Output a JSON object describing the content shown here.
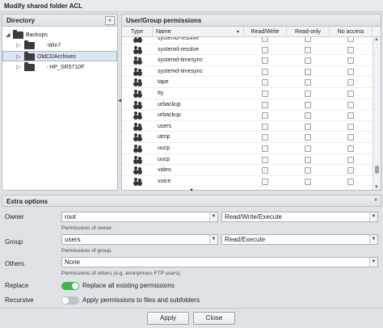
{
  "window": {
    "title": "Modify shared folder ACL"
  },
  "directory": {
    "header": "Directory",
    "collapse_glyph": "«",
    "items": [
      {
        "label": "Backups",
        "expanded": true
      },
      {
        "label": "-Win7"
      },
      {
        "label": "OldCDArchives",
        "selected": true
      },
      {
        "label": "- HP_SR5710F"
      }
    ]
  },
  "permissions": {
    "header": "User/Group permissions",
    "columns": [
      "Type",
      "Name",
      "Read/Write",
      "Read-only",
      "No access"
    ],
    "sort_glyph": "▲",
    "rows": [
      {
        "name": "systemd-resolve"
      },
      {
        "name": "systemd-resolve"
      },
      {
        "name": "systemd-timesync"
      },
      {
        "name": "systemd-timesync"
      },
      {
        "name": "tape"
      },
      {
        "name": "tty"
      },
      {
        "name": "urbackup"
      },
      {
        "name": "urbackup"
      },
      {
        "name": "users"
      },
      {
        "name": "utmp"
      },
      {
        "name": "uucp"
      },
      {
        "name": "uucp"
      },
      {
        "name": "video"
      },
      {
        "name": "voice"
      }
    ]
  },
  "extra_options": {
    "header": "Extra options",
    "owner": {
      "label": "Owner",
      "value": "root",
      "perm": "Read/Write/Execute",
      "hint": "Permissions of owner."
    },
    "group": {
      "label": "Group",
      "value": "users",
      "perm": "Read/Execute",
      "hint": "Permissions of group."
    },
    "others": {
      "label": "Others",
      "perm": "None",
      "hint": "Permissions of others (e.g. anonymous FTP users)."
    },
    "replace": {
      "label": "Replace",
      "on": true,
      "text": "Replace all existing permissions"
    },
    "recursive": {
      "label": "Recursive",
      "on": false,
      "text": "Apply permissions to files and subfolders"
    }
  },
  "buttons": {
    "apply": "Apply",
    "close": "Close"
  },
  "colors": {
    "toggle_on": "#3fb54a",
    "selection": "#dce6f3"
  }
}
